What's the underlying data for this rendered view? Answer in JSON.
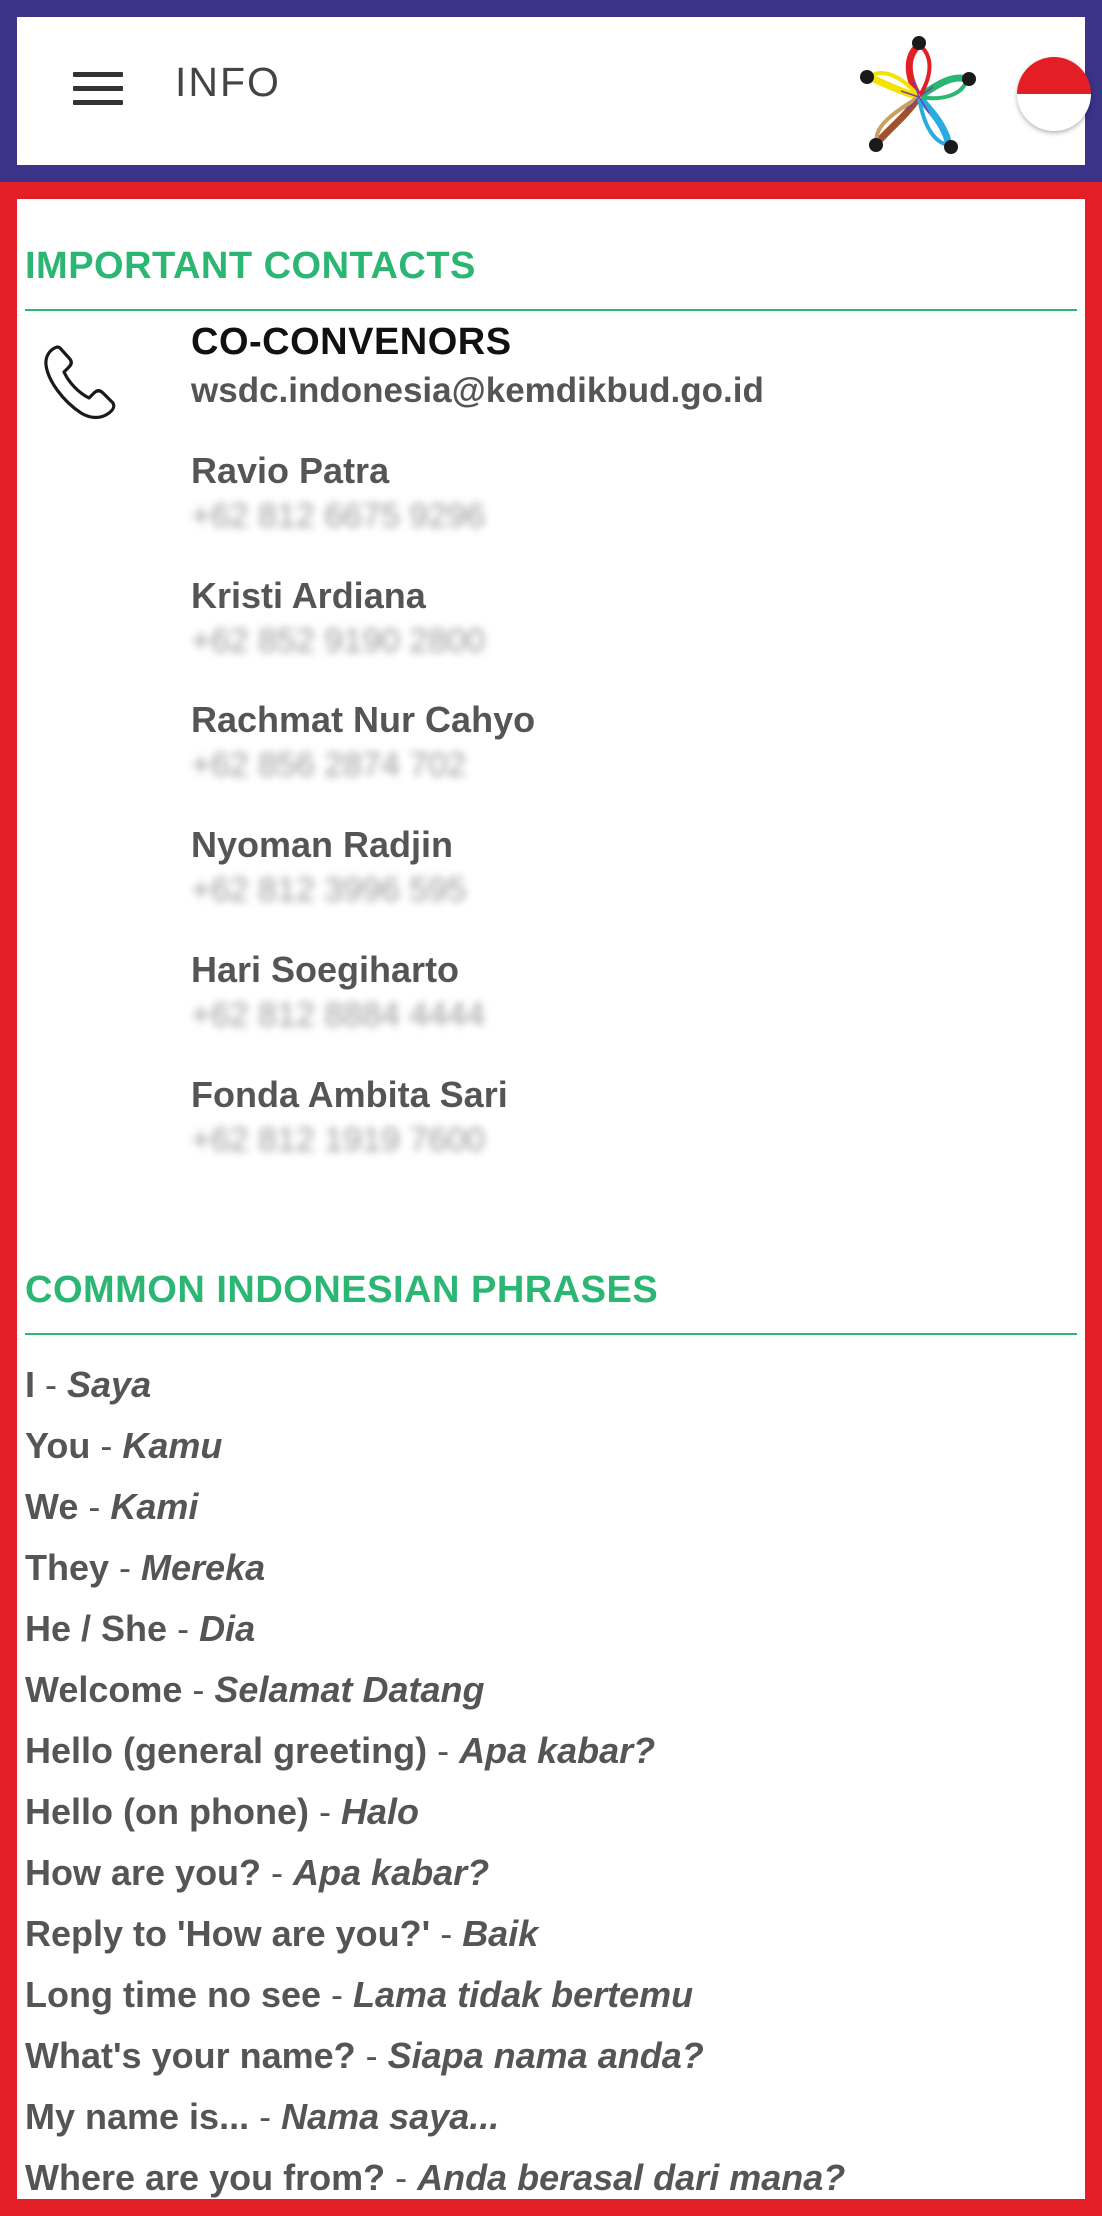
{
  "header": {
    "title": "INFO"
  },
  "contacts_section": {
    "title": "IMPORTANT CONTACTS",
    "heading": "CO-CONVENORS",
    "email": "wsdc.indonesia@kemdikbud.go.id",
    "contacts": [
      {
        "name": "Ravio Patra",
        "phone": "+62 812 6675 9296"
      },
      {
        "name": "Kristi Ardiana",
        "phone": "+62 852 9190 2800"
      },
      {
        "name": "Rachmat Nur Cahyo",
        "phone": "+62 856 2874 702"
      },
      {
        "name": "Nyoman Radjin",
        "phone": "+62 812 3996 595"
      },
      {
        "name": "Hari Soegiharto",
        "phone": "+62 812 8884 4444"
      },
      {
        "name": "Fonda Ambita Sari",
        "phone": "+62 812 1919 7600"
      }
    ]
  },
  "phrases_section": {
    "title": "COMMON INDONESIAN PHRASES",
    "separator": " - ",
    "phrases": [
      {
        "en": "I",
        "id": "Saya"
      },
      {
        "en": "You",
        "id": "Kamu"
      },
      {
        "en": "We",
        "id": "Kami"
      },
      {
        "en": "They",
        "id": "Mereka"
      },
      {
        "en": "He / She",
        "id": "Dia"
      },
      {
        "en": "Welcome",
        "id": "Selamat Datang"
      },
      {
        "en": "Hello (general greeting)",
        "id": "Apa kabar?"
      },
      {
        "en": "Hello (on phone)",
        "id": "Halo"
      },
      {
        "en": "How are you?",
        "id": "Apa kabar?"
      },
      {
        "en": "Reply to 'How are you?'",
        "id": "Baik"
      },
      {
        "en": "Long time no see",
        "id": "Lama tidak bertemu"
      },
      {
        "en": "What's your name?",
        "id": "Siapa nama anda?"
      },
      {
        "en": "My name is...",
        "id": "Nama saya..."
      },
      {
        "en": "Where are you from?",
        "id": "Anda berasal dari mana?"
      }
    ]
  },
  "colors": {
    "header_border": "#3a3388",
    "content_border": "#e31e24",
    "accent_green": "#2bb673",
    "flag_red": "#e31e24"
  },
  "icons": {
    "menu": "hamburger-menu-icon",
    "logo": "flower-logo-icon",
    "language": "indonesia-flag-icon",
    "contact": "phone-icon"
  }
}
